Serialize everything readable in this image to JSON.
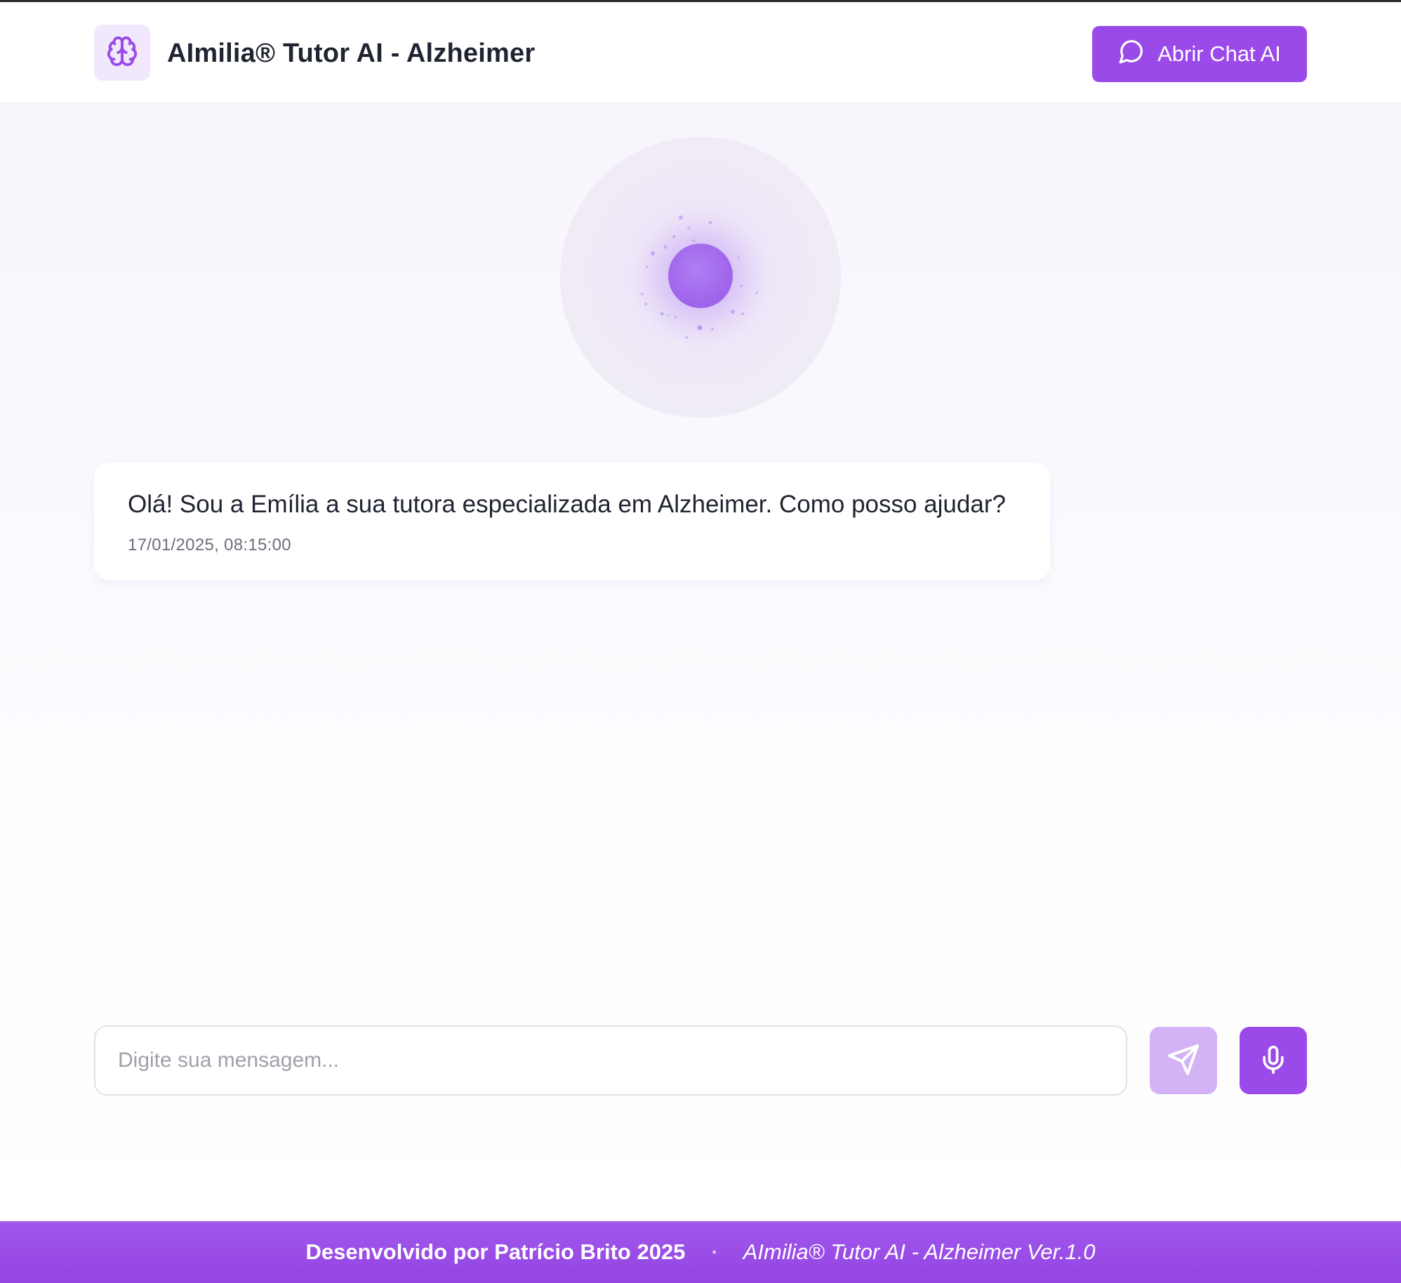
{
  "header": {
    "title": "AImilia® Tutor AI - Alzheimer",
    "logo_icon": "brain-icon",
    "open_chat_label": "Abrir Chat AI",
    "open_chat_icon": "message-circle-icon"
  },
  "chat": {
    "messages": [
      {
        "text": "Olá! Sou a Emília a sua tutora especializada em Alzheimer. Como posso ajudar?",
        "timestamp": "17/01/2025, 08:15:00"
      }
    ]
  },
  "composer": {
    "placeholder": "Digite sua mensagem...",
    "send_icon": "send-icon",
    "mic_icon": "microphone-icon"
  },
  "footer": {
    "credit": "Desenvolvido por Patrício Brito 2025",
    "separator": "•",
    "version": "AImilia® Tutor AI - Alzheimer Ver.1.0"
  },
  "colors": {
    "accent": "#9a4ae8",
    "accent_light": "#d3b3f6",
    "logo_bg": "#f1e8fd",
    "footer_bg": "#9a4ae8"
  }
}
